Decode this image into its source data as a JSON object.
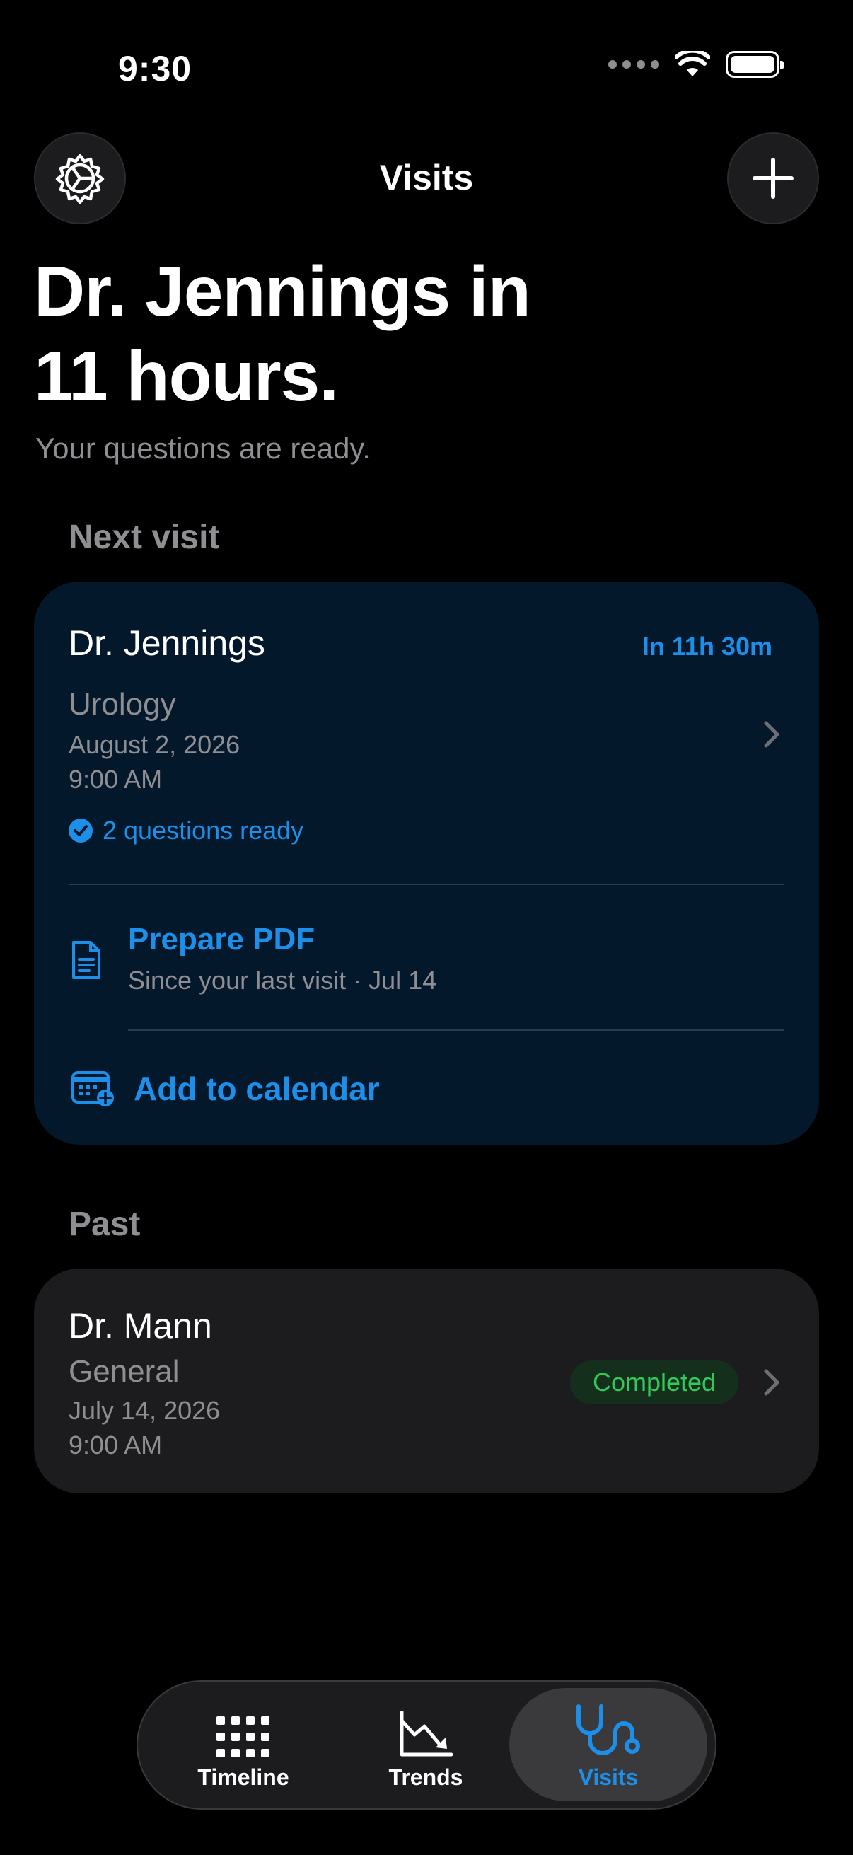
{
  "status_bar": {
    "time": "9:30"
  },
  "nav": {
    "title": "Visits",
    "settings_icon": "gear-icon",
    "add_icon": "plus-icon"
  },
  "headline": {
    "line1": "Dr. Jennings in",
    "line2": "11 hours.",
    "subtitle": "Your questions are ready."
  },
  "next_visit": {
    "section_label": "Next visit",
    "doctor": "Dr. Jennings",
    "countdown": "In 11h 30m",
    "specialty": "Urology",
    "date": "August 2, 2026",
    "time": "9:00 AM",
    "questions_ready": "2 questions ready",
    "pdf_title": "Prepare PDF",
    "pdf_subtitle": "Since your last visit · Jul 14",
    "calendar_label": "Add to calendar"
  },
  "past": {
    "section_label": "Past",
    "items": [
      {
        "doctor": "Dr. Mann",
        "specialty": "General",
        "date": "July 14, 2026",
        "time": "9:00 AM",
        "status": "Completed"
      }
    ]
  },
  "tabs": [
    {
      "label": "Timeline",
      "icon": "grid-icon",
      "active": false
    },
    {
      "label": "Trends",
      "icon": "chart-icon",
      "active": false
    },
    {
      "label": "Visits",
      "icon": "stethoscope-icon",
      "active": true
    }
  ],
  "colors": {
    "accent": "#1e8fe8",
    "success": "#34c759",
    "card_next": "#03182b",
    "card_past": "#1c1c1e"
  }
}
